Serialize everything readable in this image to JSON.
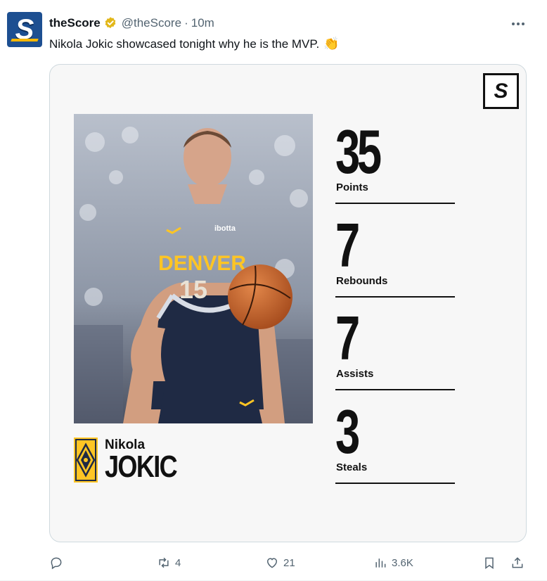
{
  "author": {
    "display_name": "theScore",
    "handle": "@theScore",
    "separator": "·",
    "time": "10m",
    "avatar_letter": "S"
  },
  "tweet": {
    "text": "Nikola Jokic showcased tonight why he is the MVP.",
    "emoji": "👏"
  },
  "card": {
    "logo_letter": "S",
    "player_first_name": "Nikola",
    "player_last_name": "JOKIC",
    "jersey_team": "DENVER",
    "jersey_number": "15",
    "jersey_sponsor": "ibotta",
    "stats": [
      {
        "value": "35",
        "label": "Points"
      },
      {
        "value": "7",
        "label": "Rebounds"
      },
      {
        "value": "7",
        "label": "Assists"
      },
      {
        "value": "3",
        "label": "Steals"
      }
    ]
  },
  "actions": {
    "reply": {
      "icon": "reply-icon",
      "count": ""
    },
    "retweet": {
      "icon": "retweet-icon",
      "count": "4"
    },
    "like": {
      "icon": "heart-icon",
      "count": "21"
    },
    "views": {
      "icon": "analytics-icon",
      "count": "3.6K"
    },
    "bookmark": {
      "icon": "bookmark-icon"
    },
    "share": {
      "icon": "share-icon"
    }
  },
  "colors": {
    "avatar_bg": "#1d4f91",
    "accent_gold": "#f5b700",
    "verified_gold": "#e2b719",
    "jersey_navy": "#1f2a44",
    "jersey_gold": "#fec524",
    "muted_text": "#536471"
  }
}
